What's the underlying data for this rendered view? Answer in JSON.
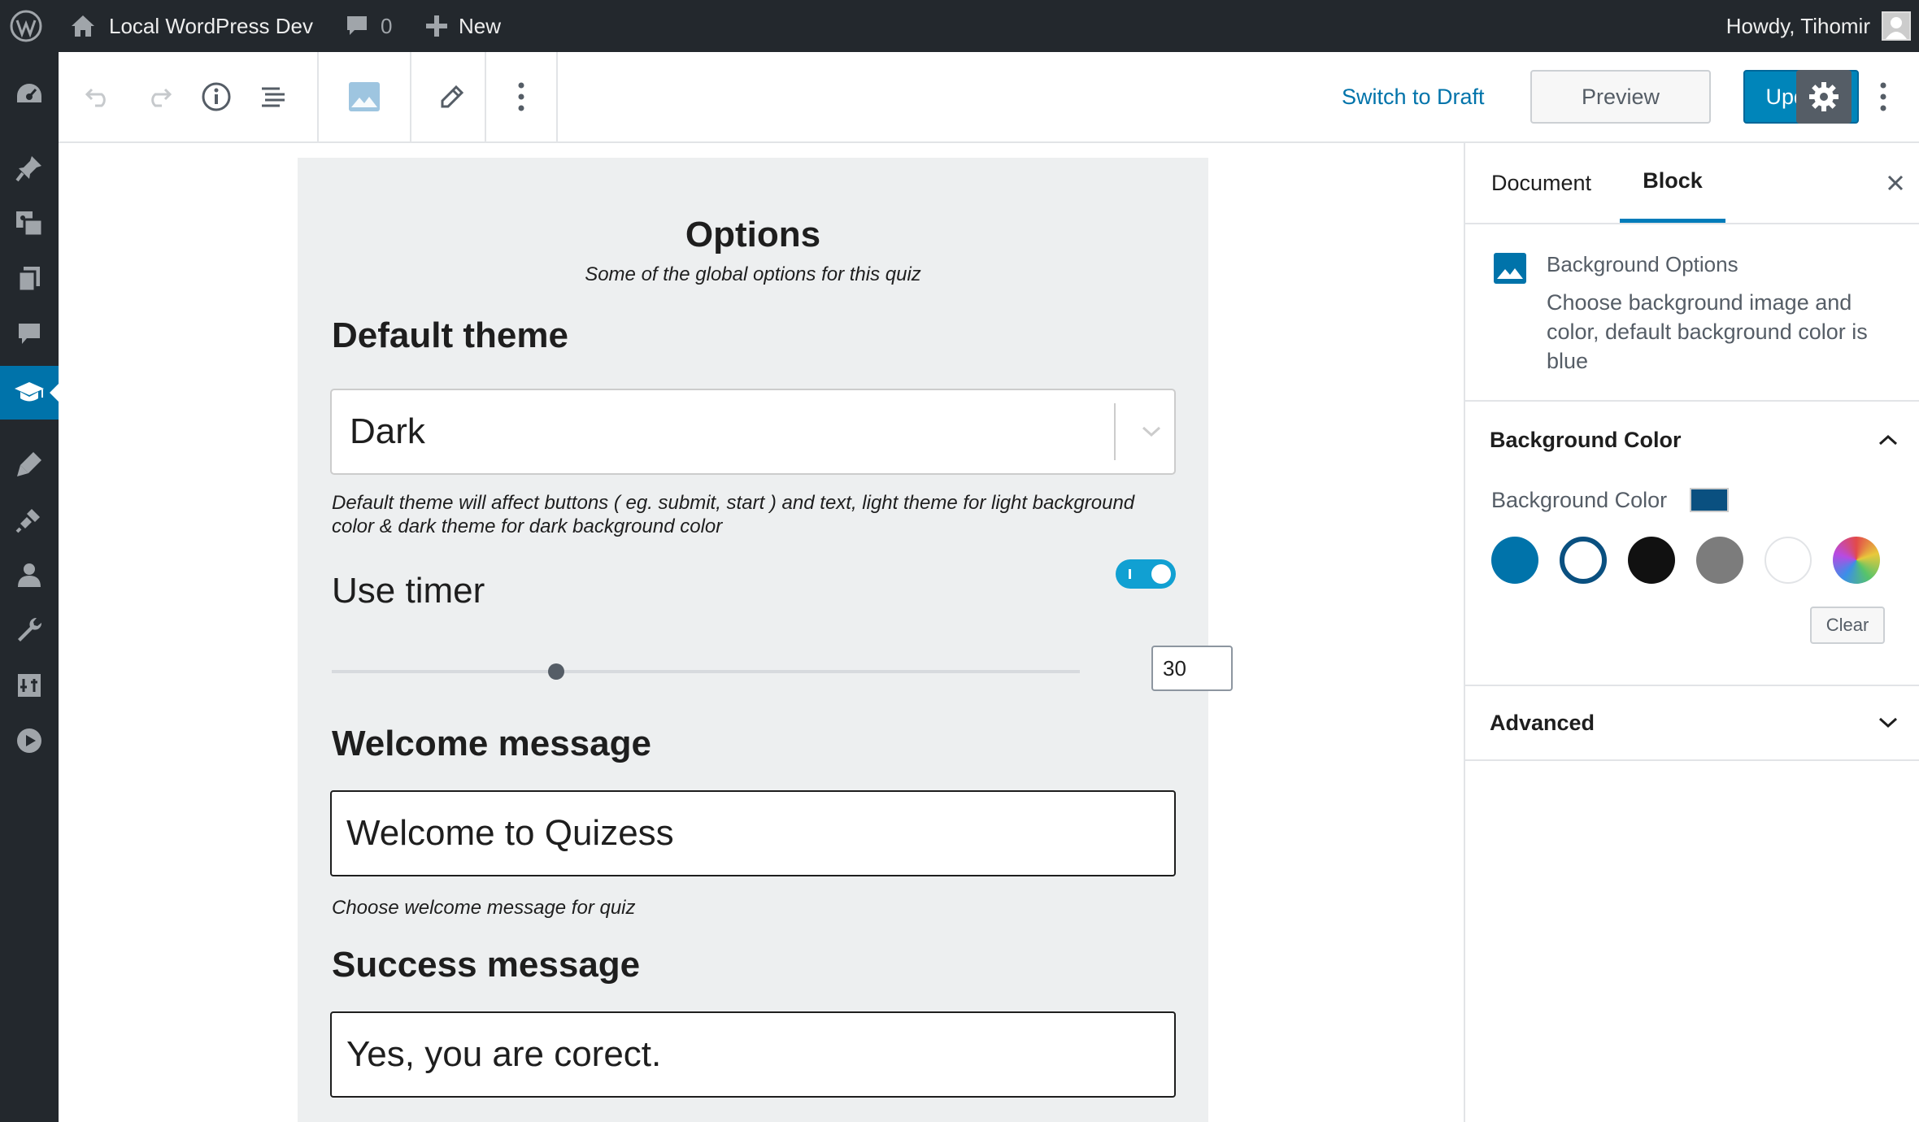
{
  "admin_bar": {
    "site_name": "Local WordPress Dev",
    "comments_count": "0",
    "new_label": "New",
    "greeting": "Howdy, Tihomir"
  },
  "admin_menu": {
    "icons": [
      "dashboard-icon",
      "posts-icon",
      "media-icon",
      "pages-icon",
      "comments-icon",
      "quiz-icon",
      "appearance-icon",
      "plugins-icon",
      "users-icon",
      "tools-icon",
      "settings-icon",
      "video-icon"
    ],
    "current": "quiz-icon"
  },
  "header": {
    "switch_to_draft": "Switch to Draft",
    "preview": "Preview",
    "update": "Update"
  },
  "block": {
    "title": "Options",
    "subtitle": "Some of the global options for this quiz",
    "default_theme": {
      "heading": "Default theme",
      "selected": "Dark",
      "help": "Default theme will affect buttons ( eg. submit, start ) and text, light theme for light background color & dark theme for dark background color"
    },
    "timer": {
      "label": "Use timer",
      "enabled": true,
      "value": "30",
      "slider_fraction": 0.3
    },
    "welcome": {
      "heading": "Welcome message",
      "value": "Welcome to Quizess",
      "help": "Choose welcome message for quiz"
    },
    "success": {
      "heading": "Success message",
      "value": "Yes, you are corect."
    }
  },
  "sidebar": {
    "tabs": [
      "Document",
      "Block"
    ],
    "active_tab": "Block",
    "block_card": {
      "title": "Background Options",
      "description": "Choose background image and color, default background color is blue"
    },
    "background_color_panel": {
      "title": "Background Color",
      "label": "Background Color",
      "selected_color": "#0a5080",
      "palette": [
        "#0073aa",
        "#0a5080",
        "#111111",
        "#7c7c7c",
        "#ffffff",
        "gradient"
      ],
      "clear": "Clear"
    },
    "advanced_panel": {
      "title": "Advanced"
    }
  },
  "colors": {
    "admin_bar": "#23282d",
    "accent": "#0073aa",
    "update_button": "#0085ba",
    "block_background": "#edeff0",
    "toggle_on": "#11a0d2"
  }
}
